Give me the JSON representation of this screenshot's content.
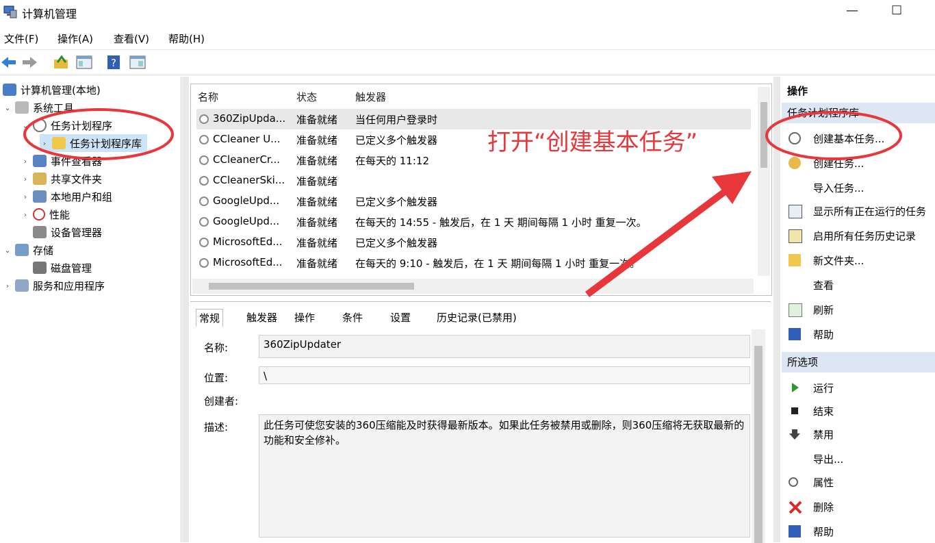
{
  "window": {
    "title": "计算机管理",
    "minimize": "—",
    "maximize": "☐"
  },
  "menu": [
    "文件(F)",
    "操作(A)",
    "查看(V)",
    "帮助(H)"
  ],
  "tree": {
    "root": "计算机管理(本地)",
    "items": [
      {
        "label": "系统工具"
      },
      {
        "label": "任务计划程序"
      },
      {
        "label": "任务计划程序库"
      },
      {
        "label": "事件查看器"
      },
      {
        "label": "共享文件夹"
      },
      {
        "label": "本地用户和组"
      },
      {
        "label": "性能"
      },
      {
        "label": "设备管理器"
      },
      {
        "label": "存储"
      },
      {
        "label": "磁盘管理"
      },
      {
        "label": "服务和应用程序"
      }
    ]
  },
  "tasklist": {
    "columns": [
      "名称",
      "状态",
      "触发器"
    ],
    "rows": [
      {
        "name": "360ZipUpda...",
        "status": "准备就绪",
        "trigger": "当任何用户登录时"
      },
      {
        "name": "CCleaner U...",
        "status": "准备就绪",
        "trigger": "已定义多个触发器"
      },
      {
        "name": "CCleanerCr...",
        "status": "准备就绪",
        "trigger": "在每天的 11:12"
      },
      {
        "name": "CCleanerSki...",
        "status": "准备就绪",
        "trigger": ""
      },
      {
        "name": "GoogleUpd...",
        "status": "准备就绪",
        "trigger": "已定义多个触发器"
      },
      {
        "name": "GoogleUpd...",
        "status": "准备就绪",
        "trigger": "在每天的 14:55 - 触发后，在 1 天 期间每隔 1 小时 重复一次。"
      },
      {
        "name": "MicrosoftEd...",
        "status": "准备就绪",
        "trigger": "已定义多个触发器"
      },
      {
        "name": "MicrosoftEd...",
        "status": "准备就绪",
        "trigger": "在每天的 9:10 - 触发后，在 1 天 期间每隔 1 小时 重复一次。"
      }
    ]
  },
  "details": {
    "tabs": [
      "常规",
      "触发器",
      "操作",
      "条件",
      "设置",
      "历史记录(已禁用)"
    ],
    "name_label": "名称:",
    "name_value": "360ZipUpdater",
    "location_label": "位置:",
    "location_value": "\\",
    "author_label": "创建者:",
    "desc_label": "描述:",
    "desc_value": "此任务可使您安装的360压缩能及时获得最新版本。如果此任务被禁用或删除，则360压缩将无获取最新的功能和安全修补。"
  },
  "actions": {
    "header": "操作",
    "section1": "任务计划程序库",
    "items1": [
      "创建基本任务...",
      "创建任务...",
      "导入任务...",
      "显示所有正在运行的任务",
      "启用所有任务历史记录",
      "新文件夹...",
      "查看",
      "刷新",
      "帮助"
    ],
    "section2": "所选项",
    "items2": [
      "运行",
      "结束",
      "禁用",
      "导出...",
      "属性",
      "删除",
      "帮助"
    ]
  },
  "annotation": {
    "text": "打开“创建基本任务”",
    "color": "#e8373a"
  }
}
